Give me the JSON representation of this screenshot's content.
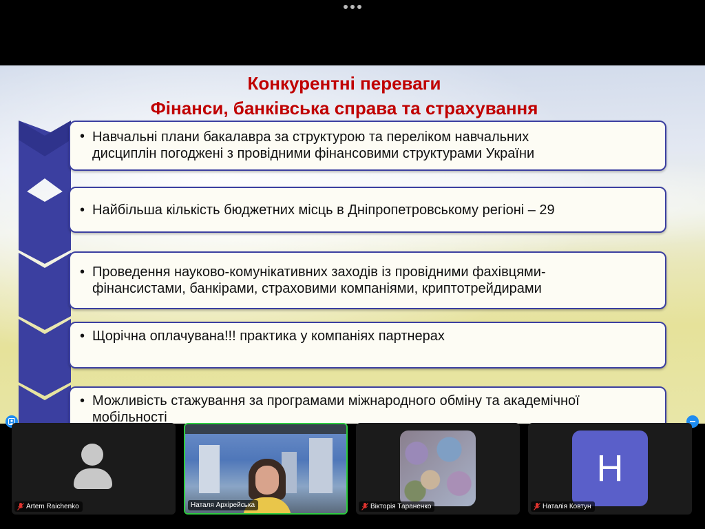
{
  "slide": {
    "title_line1": "Конкурентні переваги",
    "title_line2": "Фінанси, банківська справа та страхування",
    "bullet_symbol": "•",
    "items": [
      {
        "text_lines": [
          "Навчальні плани бакалавра за структурою та переліком навчальних",
          "дисциплін погоджені з провідними фінансовими структурами України"
        ]
      },
      {
        "text_lines": [
          "Найбільша кількість бюджетних місць в Дніпропетровському регіоні – 29"
        ]
      },
      {
        "text_lines": [
          "Проведення науково-комунікативних заходів із провідними фахівцями-",
          "фінансистами, банкірами, страховими компаніями, криптотрейдирами"
        ]
      },
      {
        "text_lines": [
          "Щорічна оплачувана!!! практика у компаніях партнерах"
        ]
      },
      {
        "text_lines": [
          "Можливість стажування за програмами міжнародного обміну та академічної",
          "мобільності"
        ]
      }
    ],
    "colors": {
      "title": "#c00000",
      "accent": "#3b3fa0"
    }
  },
  "participants": [
    {
      "name": "Artem Raichenko",
      "muted": true,
      "view": "avatar-placeholder"
    },
    {
      "name": "Наталя Архірейська",
      "muted": false,
      "view": "video",
      "active_speaker": true
    },
    {
      "name": "Вікторія Тараненко",
      "muted": true,
      "view": "profile-photo"
    },
    {
      "name": "Наталія Ковтун",
      "muted": true,
      "view": "initial",
      "initial": "H",
      "initial_color": "#5a5fc9"
    }
  ],
  "icons": {
    "top_more": "more-horizontal-icon",
    "left_corner": "screen-share-icon",
    "right_corner": "minimize-icon",
    "mic": "mic-muted-icon"
  }
}
